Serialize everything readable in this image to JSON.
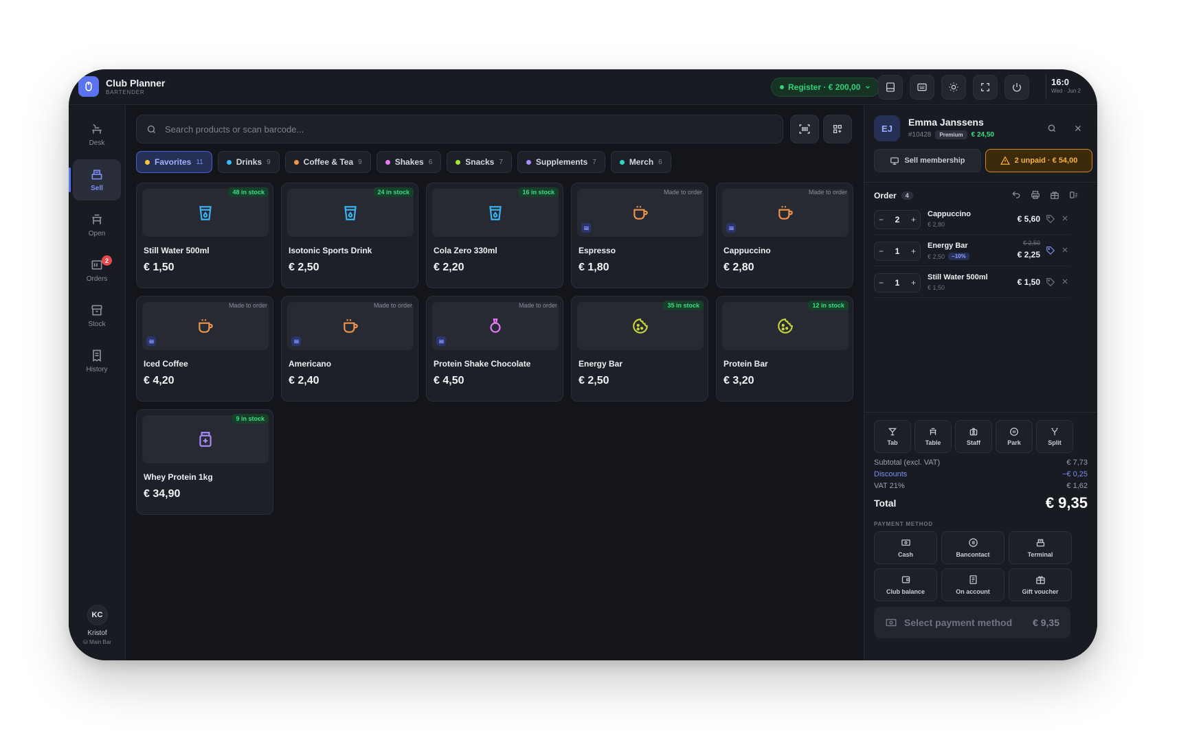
{
  "app": {
    "title": "Club Planner",
    "subtitle": "BARTENDER"
  },
  "topbar": {
    "register": "Register · € 200,00",
    "time": "16:0",
    "date": "Wed · Jun 2"
  },
  "sidebar": {
    "items": [
      {
        "label": "Desk"
      },
      {
        "label": "Sell"
      },
      {
        "label": "Open"
      },
      {
        "label": "Orders",
        "badge": "2"
      },
      {
        "label": "Stock"
      },
      {
        "label": "History"
      }
    ],
    "user": {
      "initials": "KC",
      "name": "Kristof",
      "location": "Main Bar"
    }
  },
  "search": {
    "placeholder": "Search products or scan barcode..."
  },
  "categories": [
    {
      "label": "Favorites",
      "count": "11",
      "color": "#f5c542"
    },
    {
      "label": "Drinks",
      "count": "9",
      "color": "#38bdf8"
    },
    {
      "label": "Coffee & Tea",
      "count": "9",
      "color": "#f0954a"
    },
    {
      "label": "Shakes",
      "count": "6",
      "color": "#e879f9"
    },
    {
      "label": "Snacks",
      "count": "7",
      "color": "#a3e635"
    },
    {
      "label": "Supplements",
      "count": "7",
      "color": "#a78bfa"
    },
    {
      "label": "Merch",
      "count": "6",
      "color": "#2dd4bf"
    }
  ],
  "products": [
    {
      "name": "Still Water 500ml",
      "price": "€ 1,50",
      "tag": "48 in stock",
      "icon": "cup-water-icon"
    },
    {
      "name": "Isotonic Sports Drink",
      "price": "€ 2,50",
      "tag": "24 in stock",
      "icon": "cup-water-icon"
    },
    {
      "name": "Cola Zero 330ml",
      "price": "€ 2,20",
      "tag": "16 in stock",
      "icon": "cup-water-icon"
    },
    {
      "name": "Espresso",
      "price": "€ 1,80",
      "tag": "Made to order",
      "icon": "coffee-cup-icon"
    },
    {
      "name": "Cappuccino",
      "price": "€ 2,80",
      "tag": "Made to order",
      "icon": "coffee-cup-icon"
    },
    {
      "name": "Iced Coffee",
      "price": "€ 4,20",
      "tag": "Made to order",
      "icon": "coffee-cup-icon"
    },
    {
      "name": "Americano",
      "price": "€ 2,40",
      "tag": "Made to order",
      "icon": "coffee-cup-icon"
    },
    {
      "name": "Protein Shake Chocolate",
      "price": "€ 4,50",
      "tag": "Made to order",
      "icon": "shake-icon"
    },
    {
      "name": "Energy Bar",
      "price": "€ 2,50",
      "tag": "35 in stock",
      "icon": "cookie-icon"
    },
    {
      "name": "Protein Bar",
      "price": "€ 3,20",
      "tag": "12 in stock",
      "icon": "cookie-icon"
    },
    {
      "name": "Whey Protein 1kg",
      "price": "€ 34,90",
      "tag": "9 in stock",
      "icon": "supplement-jar-icon"
    }
  ],
  "customer": {
    "initials": "EJ",
    "name": "Emma Janssens",
    "id": "#10428",
    "tier": "Premium",
    "balance": "€ 24,50",
    "sell_membership": "Sell membership",
    "unpaid": "2 unpaid · € 54,00"
  },
  "order": {
    "title": "Order",
    "count": "4",
    "lines": [
      {
        "qty": "2",
        "name": "Cappuccino",
        "unit": "€ 2,80",
        "price": "€ 5,60"
      },
      {
        "qty": "1",
        "name": "Energy Bar",
        "unit": "€ 2,50",
        "discount": "−10%",
        "old": "€ 2,50",
        "price": "€ 2,25"
      },
      {
        "qty": "1",
        "name": "Still Water 500ml",
        "unit": "€ 1,50",
        "price": "€ 1,50"
      }
    ],
    "quick": [
      "Tab",
      "Table",
      "Staff",
      "Park",
      "Split"
    ]
  },
  "totals": {
    "subtotal_label": "Subtotal (excl. VAT)",
    "subtotal": "€ 7,73",
    "discounts_label": "Discounts",
    "discounts": "−€ 0,25",
    "vat_label": "VAT 21%",
    "vat": "€ 1,62",
    "total_label": "Total",
    "total": "€ 9,35"
  },
  "payment": {
    "label": "PAYMENT METHOD",
    "methods": [
      "Cash",
      "Bancontact",
      "Terminal",
      "Club balance",
      "On account",
      "Gift voucher"
    ],
    "cta": "Select payment method",
    "cta_amount": "€ 9,35"
  }
}
